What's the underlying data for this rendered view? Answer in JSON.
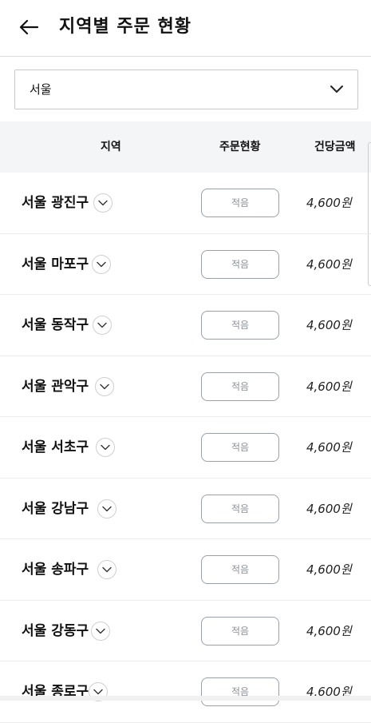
{
  "header": {
    "title": "지역별 주문 현황",
    "back_icon": "arrow-left-icon"
  },
  "region_select": {
    "value": "서울",
    "icon": "chevron-down-icon"
  },
  "table": {
    "columns": [
      "지역",
      "주문현황",
      "건당금액"
    ],
    "rows": [
      {
        "region": "서울 광진구",
        "status": "적음",
        "price": "4,600원"
      },
      {
        "region": "서울 마포구",
        "status": "적음",
        "price": "4,600원"
      },
      {
        "region": "서울 동작구",
        "status": "적음",
        "price": "4,600원"
      },
      {
        "region": "서울 관악구",
        "status": "적음",
        "price": "4,600원"
      },
      {
        "region": "서울 서초구",
        "status": "적음",
        "price": "4,600원"
      },
      {
        "region": "서울 강남구",
        "status": "적음",
        "price": "4,600원"
      },
      {
        "region": "서울 송파구",
        "status": "적음",
        "price": "4,600원"
      },
      {
        "region": "서울 강동구",
        "status": "적음",
        "price": "4,600원"
      },
      {
        "region": "서울 종로구",
        "status": "적음",
        "price": "4,600원"
      }
    ]
  }
}
